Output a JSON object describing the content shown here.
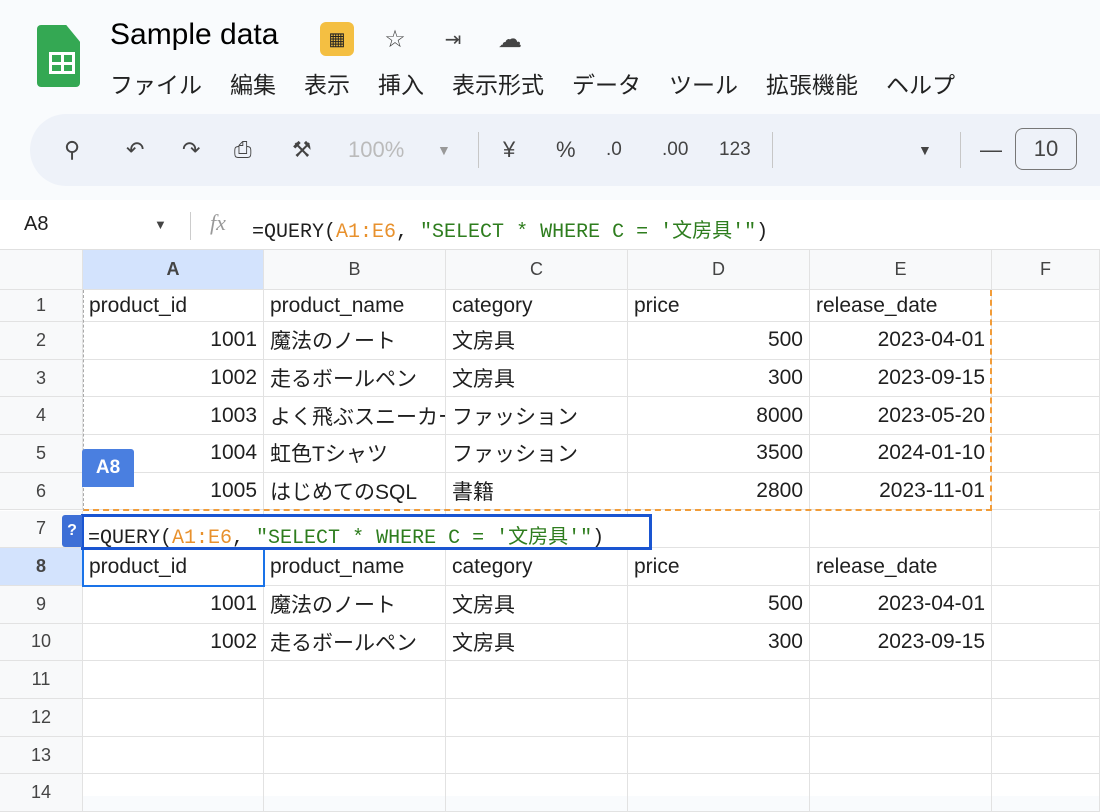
{
  "app": {
    "title": "Sample data"
  },
  "menu": [
    "ファイル",
    "編集",
    "表示",
    "挿入",
    "表示形式",
    "データ",
    "ツール",
    "拡張機能",
    "ヘルプ"
  ],
  "toolbar": {
    "zoom": "100%",
    "currency": "¥",
    "percent": "%",
    "dec_decrease": ".0",
    "dec_increase": ".00",
    "format_number": "123",
    "font_size": "10"
  },
  "formula_bar": {
    "cell_ref": "A8",
    "fx": "fx",
    "formula_prefix": "=QUERY(",
    "formula_range": "A1:E6",
    "formula_comma": ", ",
    "formula_query": "\"SELECT * WHERE C = '文房具'\"",
    "formula_suffix": ")"
  },
  "columns": [
    "A",
    "B",
    "C",
    "D",
    "E",
    "F"
  ],
  "rows": [
    [
      "1",
      "product_id",
      "product_name",
      "category",
      "price",
      "release_date"
    ],
    [
      "2",
      "1001",
      "魔法のノート",
      "文房具",
      "500",
      "2023-04-01"
    ],
    [
      "3",
      "1002",
      "走るボールペン",
      "文房具",
      "300",
      "2023-09-15"
    ],
    [
      "4",
      "1003",
      "よく飛ぶスニーカー",
      "ファッション",
      "8000",
      "2023-05-20"
    ],
    [
      "5",
      "1004",
      "虹色Tシャツ",
      "ファッション",
      "3500",
      "2024-01-10"
    ],
    [
      "6",
      "1005",
      "はじめてのSQL",
      "書籍",
      "2800",
      "2023-11-01"
    ],
    [
      "7",
      "",
      "",
      "",
      "",
      ""
    ],
    [
      "8",
      "product_id",
      "product_name",
      "category",
      "price",
      "release_date"
    ],
    [
      "9",
      "1001",
      "魔法のノート",
      "文房具",
      "500",
      "2023-04-01"
    ],
    [
      "10",
      "1002",
      "走るボールペン",
      "文房具",
      "300",
      "2023-09-15"
    ],
    [
      "11",
      "",
      "",
      "",
      "",
      ""
    ],
    [
      "12",
      "",
      "",
      "",
      "",
      ""
    ],
    [
      "13",
      "",
      "",
      "",
      "",
      ""
    ],
    [
      "14",
      "",
      "",
      "",
      "",
      ""
    ]
  ],
  "editor": {
    "cell_tag": "A8",
    "help": "?"
  }
}
